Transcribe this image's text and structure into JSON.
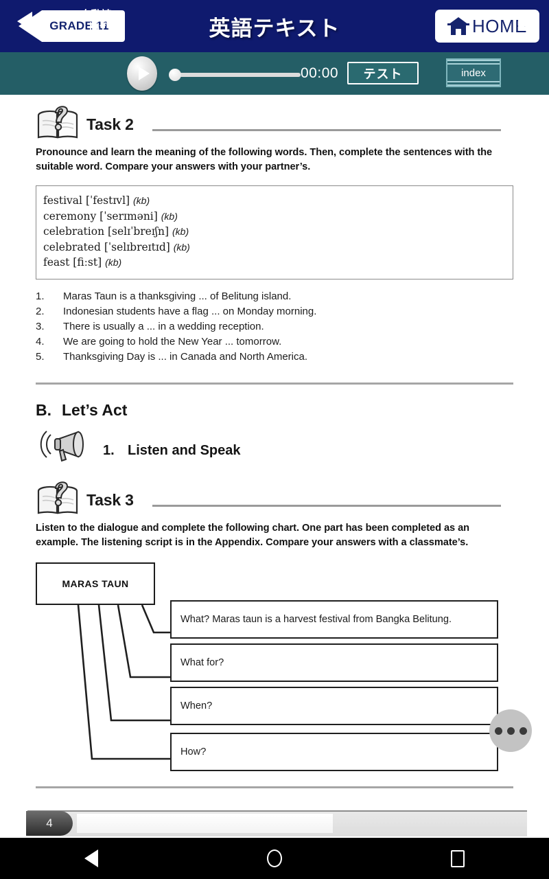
{
  "header": {
    "grade_label": "GRADE 11",
    "title": "英語テキスト",
    "home_label": "HOME",
    "home_icon": "home-icon"
  },
  "player": {
    "prev_icon": "previous-page-arrow-icon",
    "next_icon": "next-page-arrow-icon",
    "auto_read_line1": "自動読",
    "auto_read_line2": "上げ",
    "play_icon": "play-icon",
    "time": "00:00",
    "test_label": "テスト",
    "index_label": "index",
    "seek_position_pct": 0
  },
  "content": {
    "task2": {
      "icon": "book-question-icon",
      "label": "Task 2",
      "instruction": "Pronounce and learn the meaning of the following words. Then, complete the sentences with the suitable word. Compare your answers with your partner’s.",
      "wordlist": [
        {
          "word": "festival",
          "phonetic": "[ˈfestɪvl]",
          "tag": "(kb)"
        },
        {
          "word": "ceremony",
          "phonetic": "[ˈserɪməni]",
          "tag": "(kb)"
        },
        {
          "word": "celebration",
          "phonetic": "[selɪˈbreɪʃn]",
          "tag": "(kb)"
        },
        {
          "word": "celebrated",
          "phonetic": "[ˈselɪbreɪtɪd]",
          "tag": "(kb)"
        },
        {
          "word": "feast",
          "phonetic": "[fiːst]",
          "tag": "(kb)"
        }
      ],
      "sentences": [
        {
          "num": "1.",
          "text": "Maras Taun is a thanksgiving ... of Belitung island."
        },
        {
          "num": "2.",
          "text": "Indonesian students have a flag ... on Monday morning."
        },
        {
          "num": "3.",
          "text": "There is usually a ... in a wedding reception."
        },
        {
          "num": "4.",
          "text": "We are going to hold the New Year ... tomorrow."
        },
        {
          "num": "5.",
          "text": "Thanksgiving Day is ... in Canada and North America."
        }
      ]
    },
    "section_b": {
      "letter": "B.",
      "title": "Let’s Act",
      "sub_icon": "megaphone-icon",
      "sub_num": "1.",
      "sub_title": "Listen and Speak"
    },
    "task3": {
      "icon": "book-question-icon",
      "label": "Task 3",
      "instruction": "Listen to the dialogue and complete the following chart. One part has been completed as an example. The listening script is in the Appendix. Compare your answers with a classmate’s."
    }
  },
  "chart_data": {
    "type": "diagram",
    "title": "MARAS TAUN",
    "root": "MARAS TAUN",
    "branches": [
      {
        "label": "What?",
        "answer": "What? Maras taun is a harvest festival from Bangka Belitung.",
        "filled": true
      },
      {
        "label": "What for?",
        "answer": "What for?",
        "filled": false
      },
      {
        "label": "When?",
        "answer": "When?",
        "filled": false
      },
      {
        "label": "How?",
        "answer": "How?",
        "filled": false
      }
    ]
  },
  "footer": {
    "page_number": "4",
    "fab_icon": "more-options-icon",
    "android_back_icon": "android-back-icon",
    "android_home_icon": "android-home-icon",
    "android_recent_icon": "android-recent-icon"
  }
}
